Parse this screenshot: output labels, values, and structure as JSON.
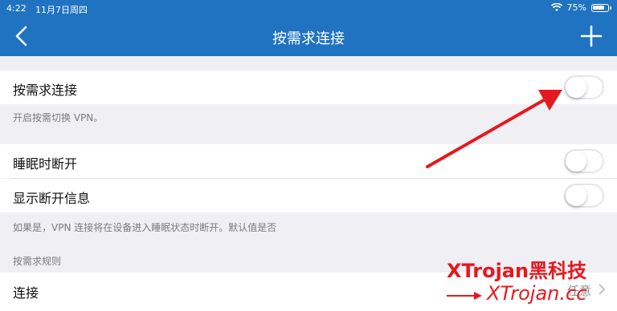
{
  "status_bar": {
    "time": "4:22",
    "date": "11月7日周四",
    "battery": "75%",
    "battery_fraction": 0.75
  },
  "nav": {
    "title": "按需求连接",
    "back_icon": "chevron-left-icon",
    "add_icon": "plus-icon"
  },
  "sections": {
    "on_demand": {
      "label": "按需求连接",
      "enabled": false,
      "footer": "开启按需切换 VPN。"
    },
    "sleep": {
      "label": "睡眠时断开",
      "enabled": false
    },
    "show_disconnect": {
      "label": "显示断开信息",
      "enabled": false
    },
    "footer2": "如果是，VPN 连接将在设备进入睡眠状态时断开。默认值是否",
    "rules_header": "按需求规则",
    "connect": {
      "label": "连接",
      "value": "任意"
    }
  },
  "watermark": {
    "line1": "XTrojan黑科技",
    "line2": "XTrojan.cc"
  },
  "colors": {
    "nav": "#1f73c1",
    "annotation": "#e6191e"
  }
}
